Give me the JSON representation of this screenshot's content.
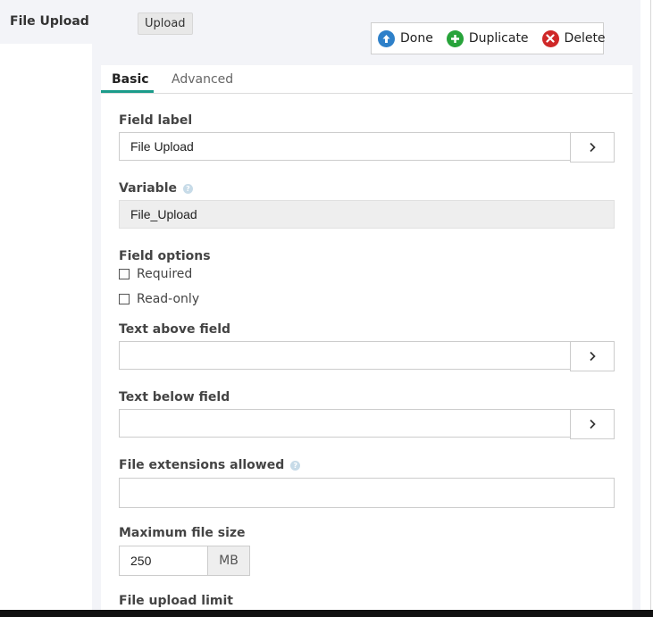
{
  "sidebar": {
    "field_name": "File Upload"
  },
  "header": {
    "type_badge": "Upload",
    "actions": {
      "done": "Done",
      "duplicate": "Duplicate",
      "delete": "Delete"
    }
  },
  "tabs": {
    "basic": "Basic",
    "advanced": "Advanced",
    "active": "Basic"
  },
  "form": {
    "field_label": {
      "label": "Field label",
      "value": "File Upload"
    },
    "variable": {
      "label": "Variable",
      "value": "File_Upload"
    },
    "field_options": {
      "label": "Field options",
      "required": {
        "label": "Required",
        "checked": false
      },
      "read_only": {
        "label": "Read-only",
        "checked": false
      }
    },
    "text_above": {
      "label": "Text above field",
      "value": ""
    },
    "text_below": {
      "label": "Text below field",
      "value": ""
    },
    "extensions": {
      "label": "File extensions allowed",
      "value": ""
    },
    "max_size": {
      "label": "Maximum file size",
      "value": "250",
      "unit": "MB"
    },
    "upload_limit": {
      "label": "File upload limit"
    }
  },
  "icons": {
    "done": "arrow-up-circle-icon",
    "duplicate": "plus-circle-icon",
    "delete": "x-circle-icon",
    "help": "question-circle-icon",
    "chevron": "chevron-right-icon"
  },
  "colors": {
    "accent_tab": "#1b9b8a",
    "done": "#2e80c9",
    "duplicate": "#27a33a",
    "delete": "#cf2828"
  }
}
